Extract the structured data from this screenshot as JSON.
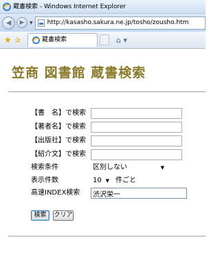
{
  "window": {
    "title": "蔵書検索 - Windows Internet Explorer"
  },
  "browser": {
    "url": "http://kasasho.sakura.ne.jp/tosho/zousho.htm",
    "tab_title": "蔵書検索"
  },
  "page": {
    "heading": "笠商 図書館 蔵書検索",
    "fields": [
      {
        "label": "【書　名】で検索",
        "value": ""
      },
      {
        "label": "【著者名】で検索",
        "value": ""
      },
      {
        "label": "【出版社】で検索",
        "value": ""
      },
      {
        "label": "【紹介文】で検索",
        "value": ""
      }
    ],
    "condition": {
      "label": "検索条件",
      "selected": "区別しない"
    },
    "count": {
      "label": "表示件数",
      "selected": "10",
      "suffix": "件ごと"
    },
    "index_search": {
      "label": "高速INDEX検索",
      "value": "渋沢栄一"
    },
    "buttons": {
      "search": "検索",
      "clear": "クリア"
    }
  },
  "colors": {
    "heading": "#8a7a2a",
    "titlebar": "#cfe0f4"
  }
}
